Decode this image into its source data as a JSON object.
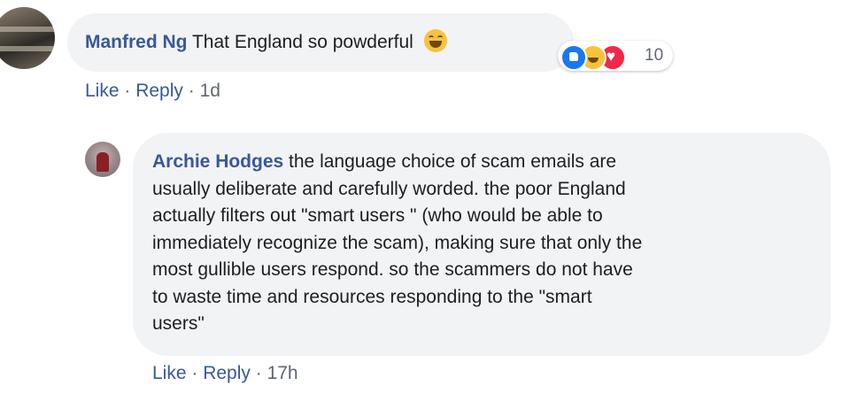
{
  "comment": {
    "author": "Manfred Ng",
    "text": "That England so powderful",
    "emoji": "grinning-squinting-face",
    "reactions": {
      "icons": [
        "like",
        "haha",
        "love"
      ],
      "count": "10"
    },
    "actions": {
      "like": "Like",
      "reply": "Reply",
      "time": "1d"
    }
  },
  "reply": {
    "author": "Archie Hodges",
    "lines": [
      "the language choice of scam emails are",
      "usually deliberate and carefully worded. the poor England",
      "actually filters out \"smart users \" (who would be able to",
      "immediately recognize the scam), making sure that only the",
      "most gullible users respond. so the scammers do not have",
      "to waste time and resources responding to the \"smart",
      "users\""
    ],
    "actions": {
      "like": "Like",
      "reply": "Reply",
      "time": "17h"
    }
  },
  "colors": {
    "link": "#385898",
    "bubble": "#f2f3f5",
    "meta": "#606770"
  }
}
